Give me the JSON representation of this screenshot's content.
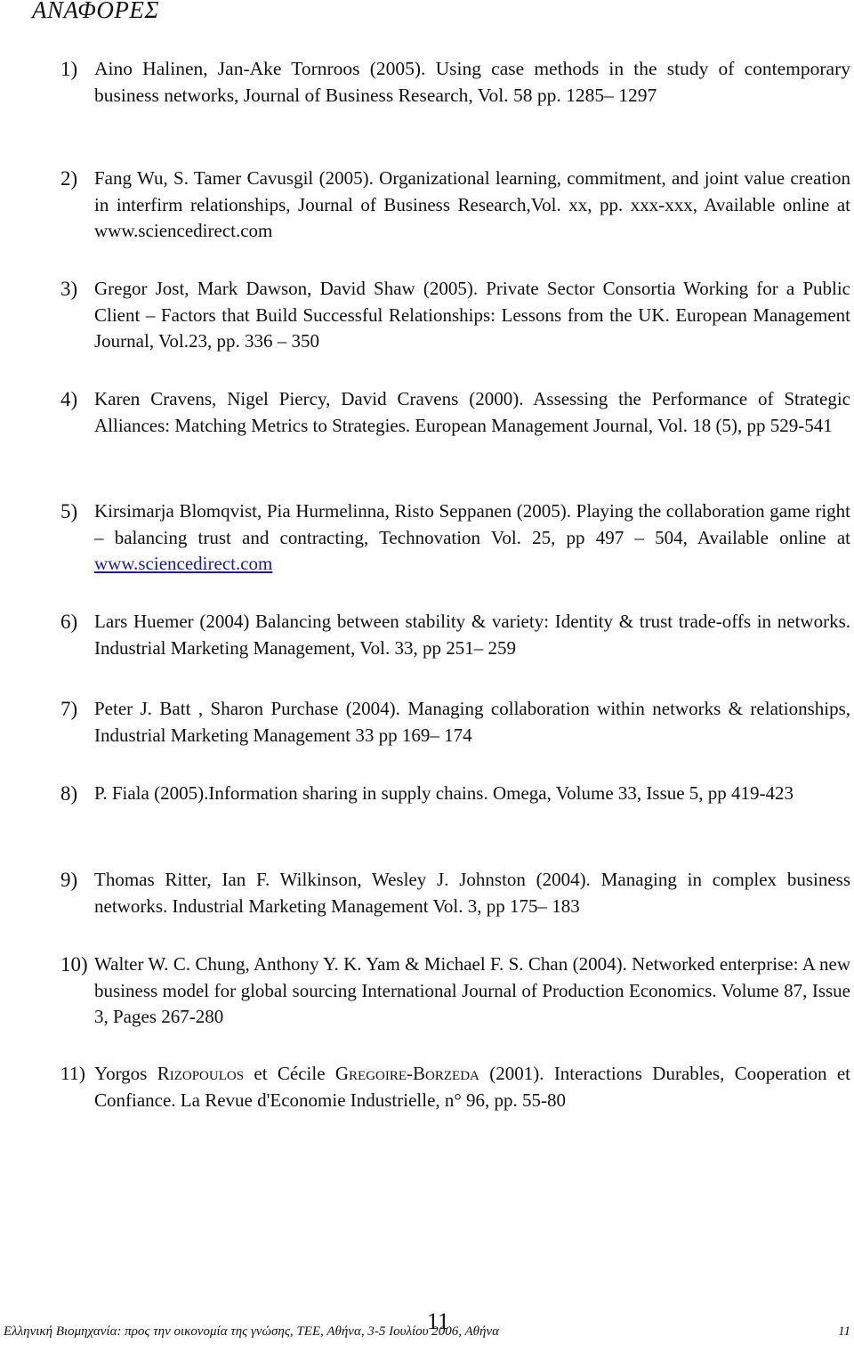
{
  "document": {
    "title": "ΑΝΑΦΟΡΕΣ",
    "references": [
      {
        "number": "1)",
        "text": "Aino Halinen, Jan-Ake Tornroos (2005). Using case methods in the study of contemporary business networks, Journal of Business Research, Vol. 58 pp. 1285– 1297"
      },
      {
        "number": "2)",
        "text": "Fang Wu, S. Tamer Cavusgil (2005). Organizational learning, commitment, and joint value creation in interfirm relationships, Journal of Business Research,Vol. xx, pp. xxx-xxx, Available online at www.sciencedirect.com"
      },
      {
        "number": "3)",
        "text": "Gregor Jost, Mark Dawson, David Shaw (2005). Private Sector Consortia Working for a Public Client – Factors that Build Successful Relationships: Lessons from the UK. European Management Journal, Vol.23, pp. 336 – 350"
      },
      {
        "number": "4)",
        "text": "Karen Cravens, Nigel Piercy, David Cravens (2000). Assessing the Performance of Strategic Alliances: Matching Metrics to Strategies. European Management Journal, Vol. 18 (5), pp 529-541"
      },
      {
        "number": "5)",
        "text_before_link": "Kirsimarja Blomqvist, Pia Hurmelinna, Risto Seppanen (2005). Playing the collaboration game right – balancing trust and contracting, Technovation Vol. 25, pp 497 – 504, Available online at ",
        "link": "www.sciencedirect.com"
      },
      {
        "number": "6)",
        "text": "Lars Huemer (2004) Balancing between stability & variety: Identity & trust trade-offs in networks. Industrial Marketing Management, Vol. 33, pp 251– 259"
      },
      {
        "number": "7)",
        "text": "Peter J. Batt , Sharon Purchase (2004). Managing collaboration within networks & relationships, Industrial Marketing Management 33 pp 169– 174"
      },
      {
        "number": "8)",
        "text": "P. Fiala (2005).Information sharing in supply chains. Omega, Volume 33, Issue 5, pp 419-423"
      },
      {
        "number": "9)",
        "text": "Thomas Ritter, Ian F. Wilkinson, Wesley J. Johnston (2004). Managing in complex business networks. Industrial Marketing Management Vol. 3, pp 175– 183"
      },
      {
        "number": "10)",
        "text": "Walter W. C. Chung, Anthony Y. K. Yam & Michael F. S. Chan (2004). Networked enterprise: A new business model for global sourcing International Journal of Production Economics. Volume 87, Issue 3, Pages 267-280"
      },
      {
        "number": "11)",
        "author1_first": "Yorgos ",
        "author1_last": "Rizopoulos",
        "connector": " et Cécile ",
        "author2_last": "Gregoire-Borzeda",
        "rest": " (2001). Interactions Durables, Cooperation et Confiance. La Revue d'Economie Industrielle, n° 96, pp. 55-80"
      }
    ]
  },
  "footer": {
    "text": "Ελληνική Βιομηχανία: προς την οικονομία της γνώσης, ΤΕΕ, Αθήνα, 3-5 Ιουλίου 2006, Αθήνα",
    "page_number": "11",
    "center_page_number": "11"
  }
}
